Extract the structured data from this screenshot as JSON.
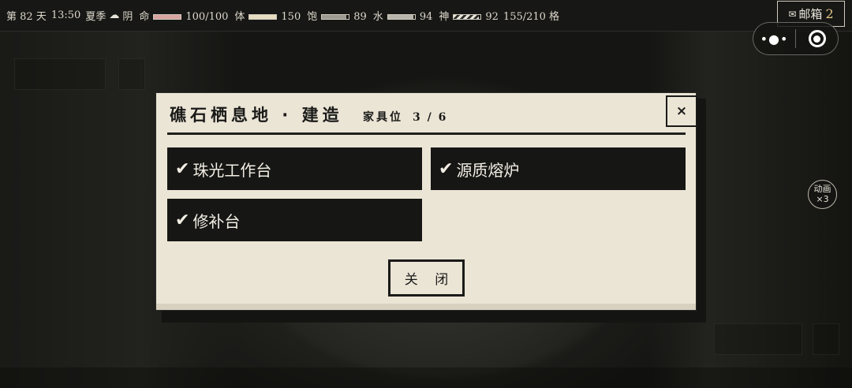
{
  "status": {
    "day_prefix": "第",
    "day": "82",
    "day_suffix": "天",
    "time": "13:50",
    "season": "夏季",
    "weather_icon": "cloud-icon",
    "weather": "阴",
    "stats": [
      {
        "label": "命",
        "value": "100/100",
        "fraction": 1.0,
        "color": "#d9a3a0"
      },
      {
        "label": "体",
        "value": "150",
        "fraction": 1.0,
        "color": "#e6dcc0"
      },
      {
        "label": "饱",
        "value": "89",
        "fraction": 0.89,
        "color": "#9c9a92"
      },
      {
        "label": "水",
        "value": "94",
        "fraction": 0.94,
        "color": "#b7b4ab"
      },
      {
        "label": "神",
        "value": "92",
        "fraction": 0.92,
        "color": "striped"
      }
    ],
    "inventory": "155/210 格"
  },
  "mail": {
    "icon": "envelope-icon",
    "label": "邮箱",
    "count": "2"
  },
  "speed_button": {
    "line1": "动画",
    "line2": "×3"
  },
  "modal": {
    "title": "礁石栖息地 · 建造",
    "slots_label": "家具位",
    "slots_value": "3 / 6",
    "close_icon": "×",
    "items": [
      {
        "check": "✔",
        "label": "珠光工作台"
      },
      {
        "check": "✔",
        "label": "源质熔炉"
      },
      {
        "check": "✔",
        "label": "修补台"
      }
    ],
    "close_button": "关 闭"
  }
}
